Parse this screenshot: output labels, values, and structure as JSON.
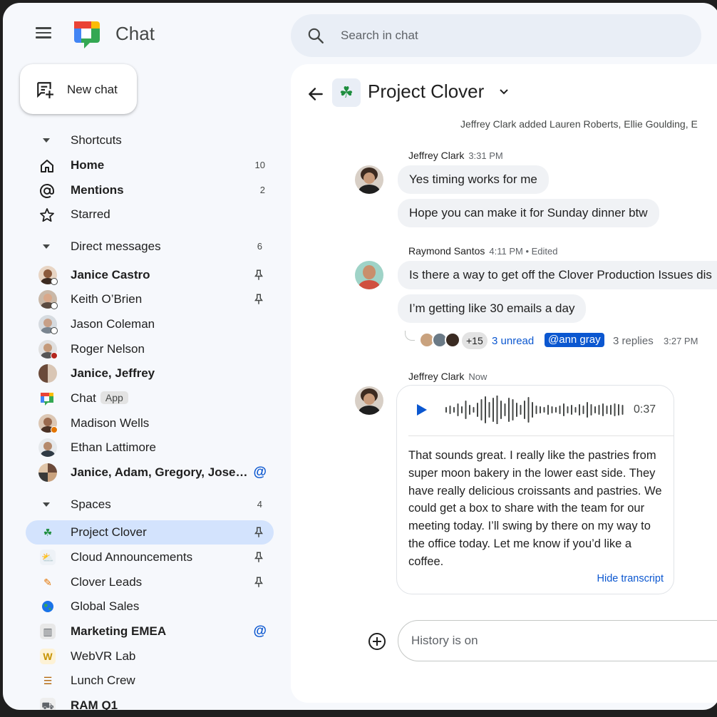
{
  "app": {
    "title": "Chat"
  },
  "search": {
    "placeholder": "Search in chat"
  },
  "new_chat": {
    "label": "New chat"
  },
  "sections": {
    "shortcuts": {
      "label": "Shortcuts"
    },
    "direct_messages": {
      "label": "Direct messages",
      "count": "6"
    },
    "spaces": {
      "label": "Spaces",
      "count": "4"
    }
  },
  "shortcuts": [
    {
      "label": "Home",
      "count": "10",
      "icon": "home-icon",
      "bold": true
    },
    {
      "label": "Mentions",
      "count": "2",
      "icon": "at-icon",
      "bold": true
    },
    {
      "label": "Starred",
      "count": "",
      "icon": "star-icon",
      "bold": false
    }
  ],
  "direct_messages": [
    {
      "label": "Janice Castro",
      "bold": true,
      "pinned": true
    },
    {
      "label": "Keith O’Brien",
      "bold": false,
      "pinned": true
    },
    {
      "label": "Jason Coleman",
      "bold": false
    },
    {
      "label": "Roger Nelson",
      "bold": false
    },
    {
      "label": "Janice, Jeffrey",
      "bold": true
    },
    {
      "label": "Chat",
      "tag": "App",
      "bold": false
    },
    {
      "label": "Madison Wells",
      "bold": false
    },
    {
      "label": "Ethan Lattimore",
      "bold": false
    },
    {
      "label": "Janice, Adam, Gregory, Jose…",
      "bold": true,
      "mention": "@"
    }
  ],
  "spaces": [
    {
      "label": "Project Clover",
      "bold": false,
      "pinned": true,
      "selected": true
    },
    {
      "label": "Cloud Announcements",
      "bold": false,
      "pinned": true
    },
    {
      "label": "Clover Leads",
      "bold": false,
      "pinned": true
    },
    {
      "label": "Global Sales",
      "bold": false
    },
    {
      "label": "Marketing EMEA",
      "bold": true,
      "mention": "@"
    },
    {
      "label": "WebVR Lab",
      "bold": false
    },
    {
      "label": "Lunch Crew",
      "bold": false
    },
    {
      "label": "RAM Q1",
      "bold": true
    }
  ],
  "conversation": {
    "title": "Project Clover",
    "system_message": "Jeffrey Clark added Lauren Roberts, Ellie Goulding, E",
    "messages": [
      {
        "sender": "Jeffrey Clark",
        "time": "3:31 PM",
        "lines": [
          "Yes timing works for me",
          "Hope you can make it for Sunday dinner btw"
        ]
      },
      {
        "sender": "Raymond Santos",
        "time": "4:11 PM • Edited",
        "lines": [
          "Is there a way to get off the Clover Production Issues dis",
          "I’m getting like 30 emails a day"
        ]
      },
      {
        "sender": "Jeffrey Clark",
        "time": "Now",
        "voice": {
          "duration": "0:37",
          "transcript": "That sounds great. I really like the pastries from super moon bakery in the lower east side. They have really delicious croissants and pastries. We could get a box to share with the team for our meeting today. I’ll swing by there on my way to the office today. Let me know if you’d like a coffee.",
          "hide_label": "Hide transcript"
        }
      }
    ],
    "thread": {
      "extra_count": "+15",
      "unread": "3 unread",
      "mention": "@ann gray",
      "replies": "3 replies",
      "time": "3:27 PM"
    },
    "composer": {
      "placeholder": "History is on"
    }
  },
  "colors": {
    "accent": "#0b57d0",
    "selected": "#d3e3fd",
    "background": "#f6f8fc"
  }
}
